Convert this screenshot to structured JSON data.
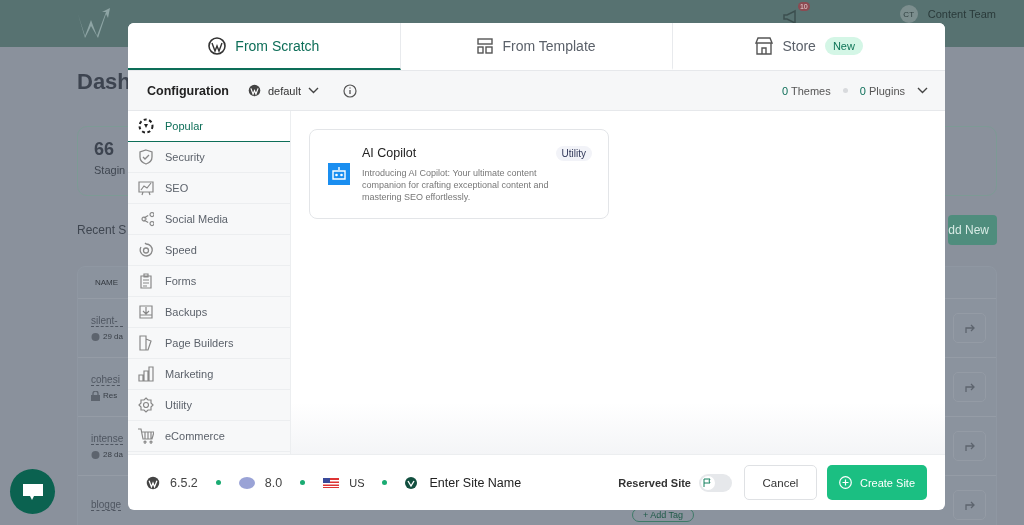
{
  "background": {
    "header": {
      "notification_badge": "10",
      "avatar": "CT",
      "user": "Content Team"
    },
    "page": {
      "title": "Dash",
      "stat": {
        "value": "66",
        "label": "Stagin"
      },
      "section_title": "Recent S",
      "add_button": "dd New",
      "table": {
        "header": "NAME",
        "rows": [
          {
            "name": "silent-",
            "meta": "29 da"
          },
          {
            "name": "cohesi",
            "meta": "Res"
          },
          {
            "name": "intense",
            "meta": "28 da"
          },
          {
            "name": "blogge",
            "meta": ""
          }
        ]
      },
      "add_tag": "+ Add Tag"
    }
  },
  "modal": {
    "tabs": [
      {
        "label": "From Scratch",
        "selected": true
      },
      {
        "label": "From Template",
        "selected": false
      },
      {
        "label": "Store",
        "selected": false,
        "badge": "New"
      }
    ],
    "config": {
      "label": "Configuration",
      "preset": "default",
      "themes_count": "0",
      "themes_label": "Themes",
      "plugins_count": "0",
      "plugins_label": "Plugins"
    },
    "categories": [
      {
        "label": "Popular",
        "selected": true
      },
      {
        "label": "Security",
        "selected": false
      },
      {
        "label": "SEO",
        "selected": false
      },
      {
        "label": "Social Media",
        "selected": false
      },
      {
        "label": "Speed",
        "selected": false
      },
      {
        "label": "Forms",
        "selected": false
      },
      {
        "label": "Backups",
        "selected": false
      },
      {
        "label": "Page Builders",
        "selected": false
      },
      {
        "label": "Marketing",
        "selected": false
      },
      {
        "label": "Utility",
        "selected": false
      },
      {
        "label": "eCommerce",
        "selected": false
      }
    ],
    "plugins": [
      {
        "title": "AI Copilot",
        "tag": "Utility",
        "description": "Introducing AI Copilot: Your ultimate content companion for crafting exceptional content and mastering SEO effortlessly."
      }
    ],
    "footer": {
      "wp_version": "6.5.2",
      "php_version": "8.0",
      "region": "US",
      "site_name_placeholder": "Enter Site Name",
      "reserved_label": "Reserved Site",
      "reserved_on": false,
      "cancel": "Cancel",
      "create": "Create Site"
    }
  }
}
